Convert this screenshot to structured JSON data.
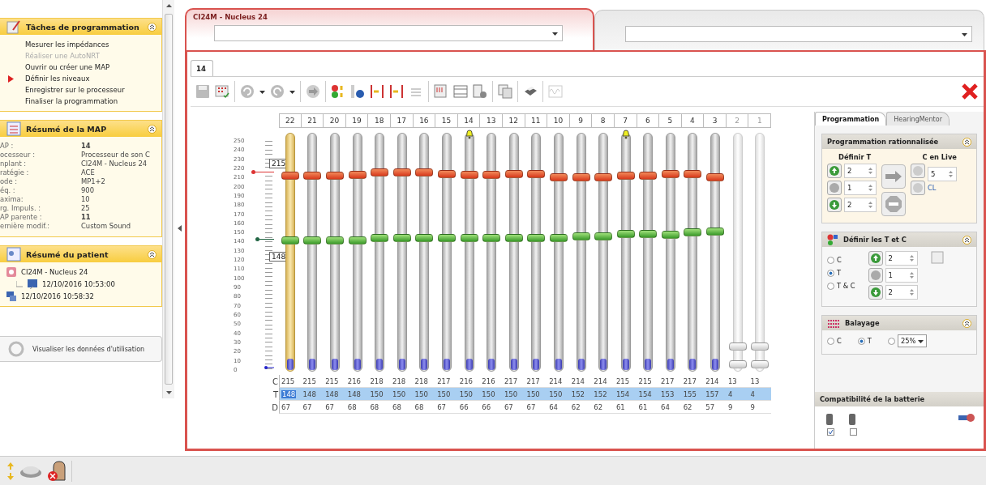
{
  "left_panel": {
    "tasks": {
      "title": "Tâches de programmation",
      "expanded": true,
      "items": [
        {
          "label": "Mesurer les impédances",
          "disabled": false,
          "current": false
        },
        {
          "label": "Réaliser une AutoNRT",
          "disabled": true,
          "current": false
        },
        {
          "label": "Ouvrir ou créer une MAP",
          "disabled": false,
          "current": false
        },
        {
          "label": "Définir les niveaux",
          "disabled": false,
          "current": true
        },
        {
          "label": "Enregistrer sur le processeur",
          "disabled": false,
          "current": false
        },
        {
          "label": "Finaliser la programmation",
          "disabled": false,
          "current": false
        }
      ]
    },
    "map_summary": {
      "title": "Résumé de la MAP",
      "expanded": true,
      "rows": [
        {
          "label": "AP :",
          "value": "14",
          "bold": true
        },
        {
          "label": "ocesseur :",
          "value": "Processeur de son C",
          "bold": false
        },
        {
          "label": "nplant :",
          "value": "CI24M - Nucleus 24",
          "bold": false
        },
        {
          "label": "ratégie :",
          "value": "ACE",
          "bold": false
        },
        {
          "label": "ode :",
          "value": "MP1+2",
          "bold": false
        },
        {
          "label": "éq. :",
          "value": "900",
          "bold": false
        },
        {
          "label": "axima:",
          "value": "10",
          "bold": false
        },
        {
          "label": "rg. Impuls. :",
          "value": "25",
          "bold": false
        },
        {
          "label": "AP parente :",
          "value": "11",
          "bold": true
        },
        {
          "label": "ernière modif.:",
          "value": "Custom Sound",
          "bold": false
        }
      ]
    },
    "patient_summary": {
      "title": "Résumé du patient",
      "expanded": true,
      "items": [
        {
          "label": "CI24M - Nucleus 24",
          "children": [
            {
              "label": "12/10/2016 10:53:00"
            }
          ]
        },
        {
          "label": "12/10/2016 10:58:32"
        }
      ]
    },
    "usage_button": "Visualiser les données d'utilisation"
  },
  "main": {
    "tabs": [
      {
        "title": "CI24M - Nucleus 24",
        "selected": true
      },
      {
        "selected": false
      }
    ],
    "map_tab": "14",
    "scale": [
      "250",
      "240",
      "230",
      "220",
      "210",
      "200",
      "190",
      "180",
      "170",
      "160",
      "150",
      "140",
      "130",
      "120",
      "110",
      "100",
      "90",
      "80",
      "70",
      "60",
      "50",
      "40",
      "30",
      "20",
      "10",
      "0"
    ],
    "row_labels": [
      "C",
      "T",
      "D"
    ],
    "c_callout": "215",
    "t_callout": "148",
    "channels": [
      {
        "number": "22",
        "enabled": true,
        "selected": true,
        "flagged": false,
        "c": "215",
        "t": "148",
        "d": "67",
        "c_slider": {
          "level": 0.83
        },
        "t_slider": {
          "level": 0.55
        }
      },
      {
        "number": "21",
        "enabled": true,
        "selected": false,
        "flagged": false,
        "c": "215",
        "t": "148",
        "d": "67",
        "c_slider": {
          "level": 0.83
        },
        "t_slider": {
          "level": 0.55
        }
      },
      {
        "number": "20",
        "enabled": true,
        "selected": false,
        "flagged": false,
        "c": "215",
        "t": "148",
        "d": "67",
        "c_slider": {
          "level": 0.83
        },
        "t_slider": {
          "level": 0.55
        }
      },
      {
        "number": "19",
        "enabled": true,
        "selected": false,
        "flagged": false,
        "c": "216",
        "t": "148",
        "d": "68",
        "c_slider": {
          "level": 0.835
        },
        "t_slider": {
          "level": 0.55
        }
      },
      {
        "number": "18",
        "enabled": true,
        "selected": false,
        "flagged": false,
        "c": "218",
        "t": "150",
        "d": "68",
        "c_slider": {
          "level": 0.845
        },
        "t_slider": {
          "level": 0.56
        }
      },
      {
        "number": "17",
        "enabled": true,
        "selected": false,
        "flagged": false,
        "c": "218",
        "t": "150",
        "d": "68",
        "c_slider": {
          "level": 0.845
        },
        "t_slider": {
          "level": 0.56
        }
      },
      {
        "number": "16",
        "enabled": true,
        "selected": false,
        "flagged": false,
        "c": "218",
        "t": "150",
        "d": "68",
        "c_slider": {
          "level": 0.845
        },
        "t_slider": {
          "level": 0.56
        }
      },
      {
        "number": "15",
        "enabled": true,
        "selected": false,
        "flagged": false,
        "c": "217",
        "t": "150",
        "d": "67",
        "c_slider": {
          "level": 0.84
        },
        "t_slider": {
          "level": 0.56
        }
      },
      {
        "number": "14",
        "enabled": true,
        "selected": false,
        "flagged": true,
        "c": "216",
        "t": "150",
        "d": "66",
        "c_slider": {
          "level": 0.835
        },
        "t_slider": {
          "level": 0.56
        }
      },
      {
        "number": "13",
        "enabled": true,
        "selected": false,
        "flagged": false,
        "c": "216",
        "t": "150",
        "d": "66",
        "c_slider": {
          "level": 0.835
        },
        "t_slider": {
          "level": 0.56
        }
      },
      {
        "number": "12",
        "enabled": true,
        "selected": false,
        "flagged": false,
        "c": "217",
        "t": "150",
        "d": "67",
        "c_slider": {
          "level": 0.84
        },
        "t_slider": {
          "level": 0.56
        }
      },
      {
        "number": "11",
        "enabled": true,
        "selected": false,
        "flagged": false,
        "c": "217",
        "t": "150",
        "d": "67",
        "c_slider": {
          "level": 0.84
        },
        "t_slider": {
          "level": 0.56
        }
      },
      {
        "number": "10",
        "enabled": true,
        "selected": false,
        "flagged": false,
        "c": "214",
        "t": "150",
        "d": "64",
        "c_slider": {
          "level": 0.825
        },
        "t_slider": {
          "level": 0.56
        }
      },
      {
        "number": "9",
        "enabled": true,
        "selected": false,
        "flagged": false,
        "c": "214",
        "t": "152",
        "d": "62",
        "c_slider": {
          "level": 0.825
        },
        "t_slider": {
          "level": 0.57
        }
      },
      {
        "number": "8",
        "enabled": true,
        "selected": false,
        "flagged": false,
        "c": "214",
        "t": "152",
        "d": "62",
        "c_slider": {
          "level": 0.825
        },
        "t_slider": {
          "level": 0.57
        }
      },
      {
        "number": "7",
        "enabled": true,
        "selected": false,
        "flagged": true,
        "c": "215",
        "t": "154",
        "d": "61",
        "c_slider": {
          "level": 0.83
        },
        "t_slider": {
          "level": 0.58
        }
      },
      {
        "number": "6",
        "enabled": true,
        "selected": false,
        "flagged": false,
        "c": "215",
        "t": "154",
        "d": "61",
        "c_slider": {
          "level": 0.83
        },
        "t_slider": {
          "level": 0.58
        }
      },
      {
        "number": "5",
        "enabled": true,
        "selected": false,
        "flagged": false,
        "c": "217",
        "t": "153",
        "d": "64",
        "c_slider": {
          "level": 0.84
        },
        "t_slider": {
          "level": 0.575
        }
      },
      {
        "number": "4",
        "enabled": true,
        "selected": false,
        "flagged": false,
        "c": "217",
        "t": "155",
        "d": "62",
        "c_slider": {
          "level": 0.84
        },
        "t_slider": {
          "level": 0.585
        }
      },
      {
        "number": "3",
        "enabled": true,
        "selected": false,
        "flagged": false,
        "c": "214",
        "t": "157",
        "d": "57",
        "c_slider": {
          "level": 0.825
        },
        "t_slider": {
          "level": 0.59
        }
      },
      {
        "number": "2",
        "enabled": false,
        "selected": false,
        "flagged": false,
        "c": "13",
        "t": "4",
        "d": "9",
        "c_slider": {
          "level": 0.09
        },
        "t_slider": {
          "level": 0.015
        }
      },
      {
        "number": "1",
        "enabled": false,
        "selected": false,
        "flagged": false,
        "c": "13",
        "t": "4",
        "d": "9",
        "c_slider": {
          "level": 0.09
        },
        "t_slider": {
          "level": 0.015
        }
      }
    ]
  },
  "right_panel": {
    "tabs": [
      {
        "label": "Programmation",
        "selected": true
      },
      {
        "label": "HearingMentor",
        "selected": false
      }
    ],
    "rationalized": {
      "title": "Programmation rationnalisée",
      "expanded": true,
      "left_label": "Définir T",
      "right_label": "C en Live",
      "steps": [
        {
          "kind": "up",
          "value": "2"
        },
        {
          "kind": "reset",
          "value": "1"
        },
        {
          "kind": "down",
          "value": "2"
        }
      ],
      "live_value": "5",
      "live_unit": "CL"
    },
    "define_tc": {
      "title": "Définir les T et C",
      "expanded": true,
      "radios": [
        {
          "label": "C",
          "selected": false
        },
        {
          "label": "T",
          "selected": true
        },
        {
          "label": "T & C",
          "selected": false
        }
      ],
      "steps": [
        {
          "kind": "up",
          "value": "2"
        },
        {
          "kind": "reset",
          "value": "1"
        },
        {
          "kind": "down",
          "value": "2"
        }
      ]
    },
    "sweep": {
      "title": "Balayage",
      "expanded": true,
      "radios": [
        {
          "label": "C",
          "selected": false
        },
        {
          "label": "T",
          "selected": true
        }
      ],
      "percent": {
        "selected": false,
        "value": "25%"
      }
    },
    "battery": {
      "title": "Compatibilité de la batterie",
      "options": [
        {
          "checked": true
        },
        {
          "checked": false
        }
      ]
    }
  }
}
